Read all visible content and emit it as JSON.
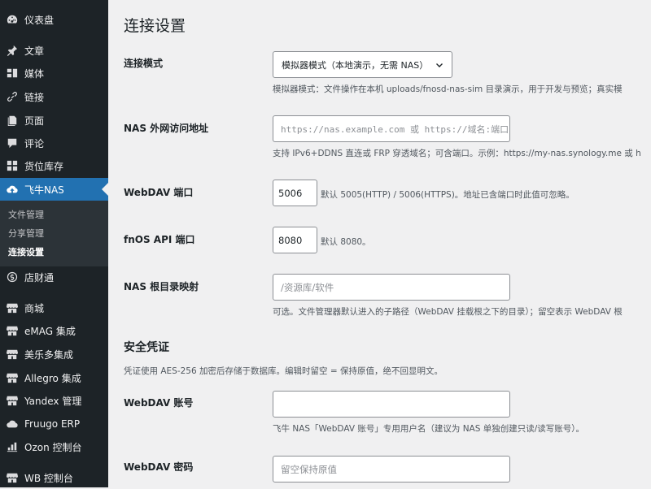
{
  "sidebar": {
    "items": [
      {
        "label": "仪表盘",
        "icon": "dashboard-icon"
      },
      {
        "label": "文章",
        "icon": "pin-icon"
      },
      {
        "label": "媒体",
        "icon": "media-icon"
      },
      {
        "label": "链接",
        "icon": "link-icon"
      },
      {
        "label": "页面",
        "icon": "page-icon"
      },
      {
        "label": "评论",
        "icon": "comment-icon"
      },
      {
        "label": "货位库存",
        "icon": "grid-icon"
      },
      {
        "label": "飞牛NAS",
        "icon": "cloud-upload-icon",
        "active": true
      },
      {
        "label": "店财通",
        "icon": "dollar-icon"
      },
      {
        "label": "商城",
        "icon": "store-icon"
      },
      {
        "label": "eMAG 集成",
        "icon": "store-icon"
      },
      {
        "label": "美乐多集成",
        "icon": "store-icon"
      },
      {
        "label": "Allegro 集成",
        "icon": "store-icon"
      },
      {
        "label": "Yandex 管理",
        "icon": "store-icon"
      },
      {
        "label": "Fruugo ERP",
        "icon": "cloud-icon"
      },
      {
        "label": "Ozon 控制台",
        "icon": "chart-icon"
      },
      {
        "label": "WB 控制台",
        "icon": "store-icon"
      }
    ],
    "submenu": [
      {
        "label": "文件管理"
      },
      {
        "label": "分享管理"
      },
      {
        "label": "连接设置",
        "current": true
      }
    ]
  },
  "page": {
    "title": "连接设置",
    "mode": {
      "label": "连接模式",
      "value": "模拟器模式（本地演示，无需 NAS）",
      "desc": "模拟器模式：文件操作在本机 uploads/fnosd-nas-sim 目录演示，用于开发与预览；真实模"
    },
    "nas_url": {
      "label": "NAS 外网访问地址",
      "placeholder": "https://nas.example.com 或 https://域名:端口",
      "desc": "支持 IPv6+DDNS 直连或 FRP 穿透域名；可含端口。示例：https://my-nas.synology.me 或 h"
    },
    "webdav_port": {
      "label": "WebDAV 端口",
      "value": "5006",
      "note": "默认 5005(HTTP) / 5006(HTTPS)。地址已含端口时此值可忽略。"
    },
    "api_port": {
      "label": "fnOS API 端口",
      "value": "8080",
      "note": "默认 8080。"
    },
    "root_map": {
      "label": "NAS 根目录映射",
      "placeholder": "/资源库/软件",
      "desc": "可选。文件管理器默认进入的子路径（WebDAV 挂载根之下的目录）；留空表示 WebDAV 根"
    },
    "security": {
      "title": "安全凭证",
      "desc": "凭证使用 AES-256 加密后存储于数据库。编辑时留空 = 保持原值，绝不回显明文。"
    },
    "webdav_account": {
      "label": "WebDAV 账号",
      "value": "",
      "desc": "飞牛 NAS「WebDAV 账号」专用用户名（建议为 NAS 单独创建只读/读写账号）。"
    },
    "webdav_password": {
      "label": "WebDAV 密码",
      "placeholder": "留空保持原值"
    }
  },
  "colors": {
    "sidebar_bg": "#1d2327",
    "active_bg": "#2271b1",
    "page_bg": "#f0f0f1"
  }
}
